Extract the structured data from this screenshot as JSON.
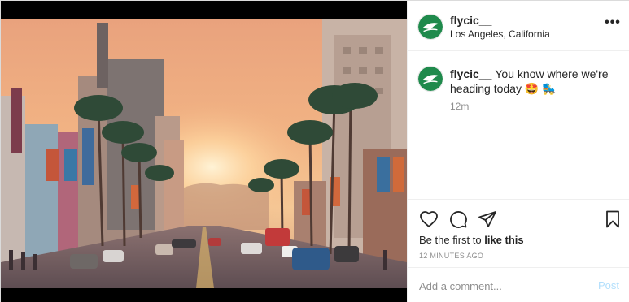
{
  "post": {
    "image": {
      "alt": "Hollywood Boulevard at sunset"
    },
    "header": {
      "username": "flycic__",
      "location": "Los Angeles, California",
      "more_label": "•••"
    },
    "caption": {
      "username": "flycic__",
      "text": "You know where we're heading today 🤩 🛼",
      "age": "12m"
    },
    "actions": {
      "like_icon": "heart-icon",
      "comment_icon": "comment-bubble-icon",
      "share_icon": "paper-plane-icon",
      "save_icon": "bookmark-icon"
    },
    "likes": {
      "prefix": "Be the first to",
      "link": "like this"
    },
    "timestamp": "12 MINUTES AGO",
    "add_comment": {
      "placeholder": "Add a comment...",
      "post_label": "Post"
    },
    "colors": {
      "avatar_green": "#1f8a4c",
      "post_button_disabled": "#b2dffc",
      "muted_text": "#8e8e8e",
      "border": "#efefef"
    }
  }
}
